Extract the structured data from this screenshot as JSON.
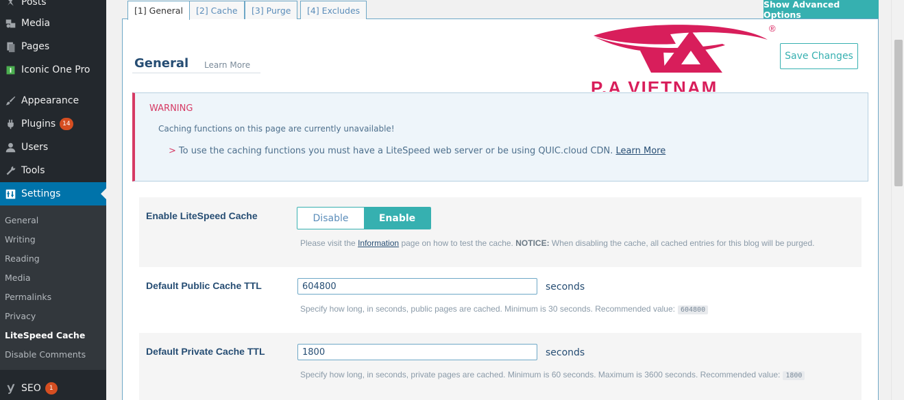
{
  "sidebar": {
    "items": [
      {
        "label": "Posts",
        "icon": "pin-icon"
      },
      {
        "label": "Media",
        "icon": "media-icon"
      },
      {
        "label": "Pages",
        "icon": "pages-icon"
      },
      {
        "label": "Iconic One Pro",
        "icon": "theme-icon"
      },
      {
        "label": "Appearance",
        "icon": "brush-icon"
      },
      {
        "label": "Plugins",
        "icon": "plugin-icon",
        "badge": "14"
      },
      {
        "label": "Users",
        "icon": "user-icon"
      },
      {
        "label": "Tools",
        "icon": "wrench-icon"
      },
      {
        "label": "Settings",
        "icon": "settings-icon",
        "active": true
      },
      {
        "label": "SEO",
        "icon": "yoast-icon",
        "badge": "1"
      }
    ],
    "submenu": [
      "General",
      "Writing",
      "Reading",
      "Media",
      "Permalinks",
      "Privacy",
      "LiteSpeed Cache",
      "Disable Comments"
    ],
    "current_submenu": "LiteSpeed Cache"
  },
  "tabs": [
    "[1] General",
    "[2] Cache",
    "[3] Purge",
    "[4] Excludes"
  ],
  "active_tab": "[1] General",
  "advanced_button": "Show Advanced Options",
  "header": {
    "title": "General",
    "learn_more": "Learn More",
    "save_button": "Save Changes",
    "logo_text": "P.A VIETNAM",
    "logo_mark": "®"
  },
  "warning": {
    "title": "WARNING",
    "line1": "Caching functions on this page are currently unavailable!",
    "line2_prefix": ">",
    "line2": "To use the caching functions you must have a LiteSpeed web server or be using QUIC.cloud CDN.",
    "line2_link": "Learn More"
  },
  "settings": {
    "enable": {
      "label": "Enable LiteSpeed Cache",
      "option_disable": "Disable",
      "option_enable": "Enable",
      "selected": "Enable",
      "desc_pre": "Please visit the",
      "desc_link": "Information",
      "desc_mid": "page on how to test the cache.",
      "desc_notice": "NOTICE:",
      "desc_post": "When disabling the cache, all cached entries for this blog will be purged."
    },
    "public_ttl": {
      "label": "Default Public Cache TTL",
      "value": "604800",
      "unit": "seconds",
      "desc": "Specify how long, in seconds, public pages are cached. Minimum is 30 seconds. Recommended value:",
      "recommended": "604800"
    },
    "private_ttl": {
      "label": "Default Private Cache TTL",
      "value": "1800",
      "unit": "seconds",
      "desc": "Specify how long, in seconds, private pages are cached. Minimum is 60 seconds. Maximum is 3600 seconds. Recommended value:",
      "recommended": "1800"
    }
  },
  "colors": {
    "sidebar_bg": "#23282d",
    "active_blue": "#0073aa",
    "accent_teal": "#36b0b0",
    "warning_red": "#d63a64",
    "logo_red": "#d81e5b"
  }
}
